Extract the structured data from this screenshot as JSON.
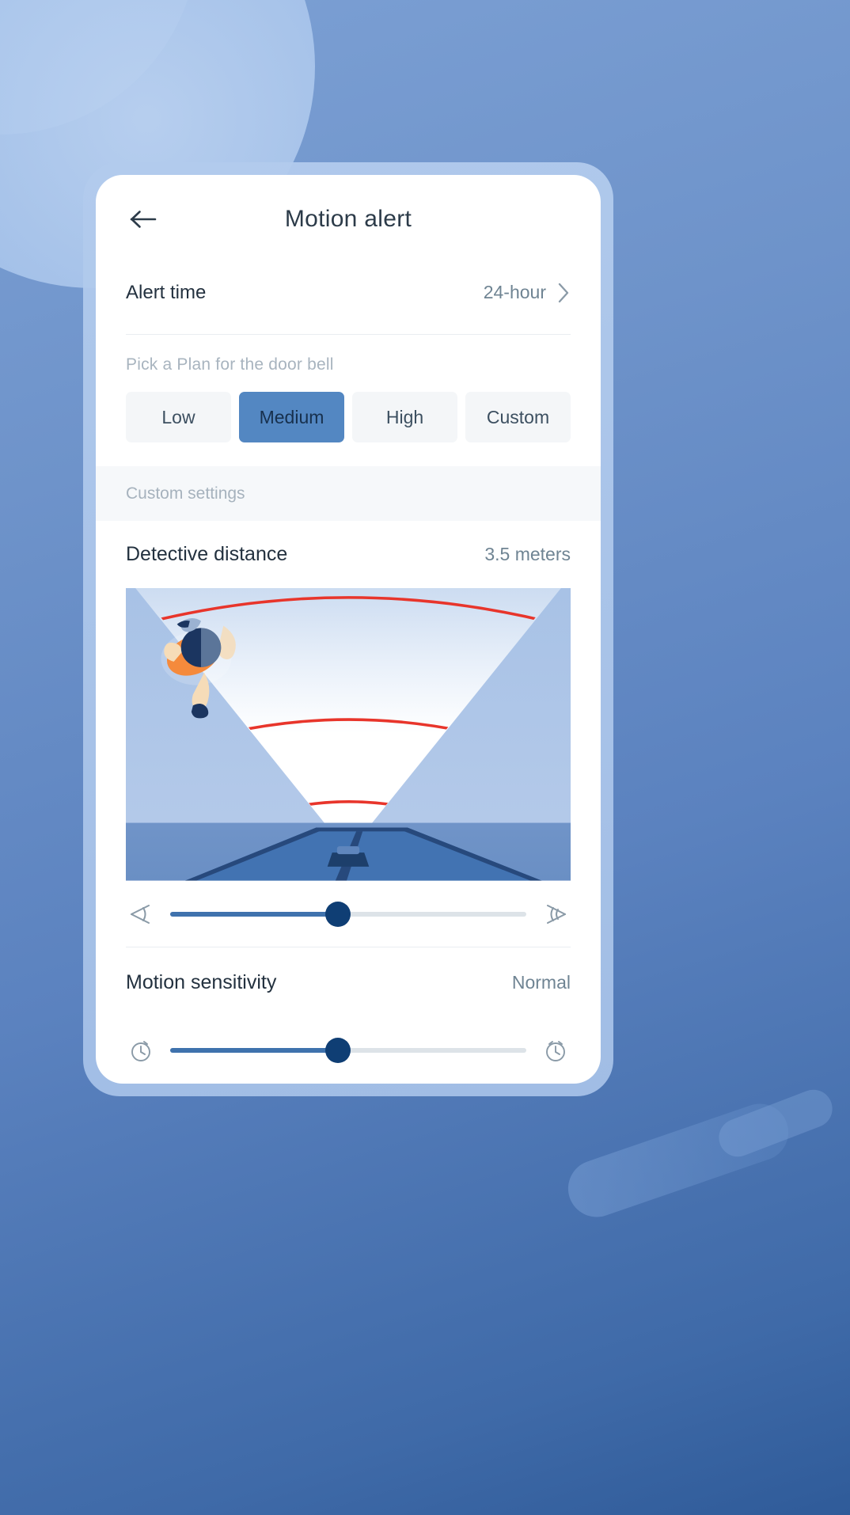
{
  "header": {
    "title": "Motion alert",
    "back_icon": "arrow-left-icon"
  },
  "alert_time": {
    "label": "Alert time",
    "value": "24-hour",
    "chevron_icon": "chevron-right-icon"
  },
  "plan": {
    "hint": "Pick a Plan for the door bell",
    "options": [
      {
        "label": "Low",
        "selected": false
      },
      {
        "label": "Medium",
        "selected": true
      },
      {
        "label": "High",
        "selected": false
      },
      {
        "label": "Custom",
        "selected": false
      }
    ],
    "selected": "Medium"
  },
  "custom_settings": {
    "section_label": "Custom settings"
  },
  "detective_distance": {
    "label": "Detective distance",
    "value": "3.5 meters",
    "slider": {
      "percent": 47,
      "left_icon": "narrow-angle-icon",
      "right_icon": "wide-angle-icon"
    }
  },
  "motion_sensitivity": {
    "label": "Motion sensitivity",
    "value": "Normal",
    "slider": {
      "percent": 47,
      "left_icon": "timer-slow-icon",
      "right_icon": "timer-fast-icon"
    }
  },
  "illustration": {
    "name": "detection-cone-diagram",
    "sky_color": "#aec6e8",
    "cone_color": "#ffffff",
    "arc_color": "#e8352b",
    "floor_color": "#6b8fc4",
    "door_color": "#2b5288",
    "device_color": "#1d3f6b",
    "person_shirt_color": "#f58a3c",
    "person_hair_color": "#1b3560",
    "person_skin_color": "#f6dcb8",
    "arcs": [
      3,
      2,
      1
    ]
  },
  "colors": {
    "accent": "#5387c2",
    "track_fill": "#3f72ad",
    "thumb": "#0f3e74",
    "text_primary": "#23313f",
    "text_secondary": "#6f8493",
    "text_muted": "#a8b4bf",
    "card_bg": "#ffffff",
    "band_bg": "#f6f8fa",
    "chip_bg": "#f4f6f8"
  }
}
